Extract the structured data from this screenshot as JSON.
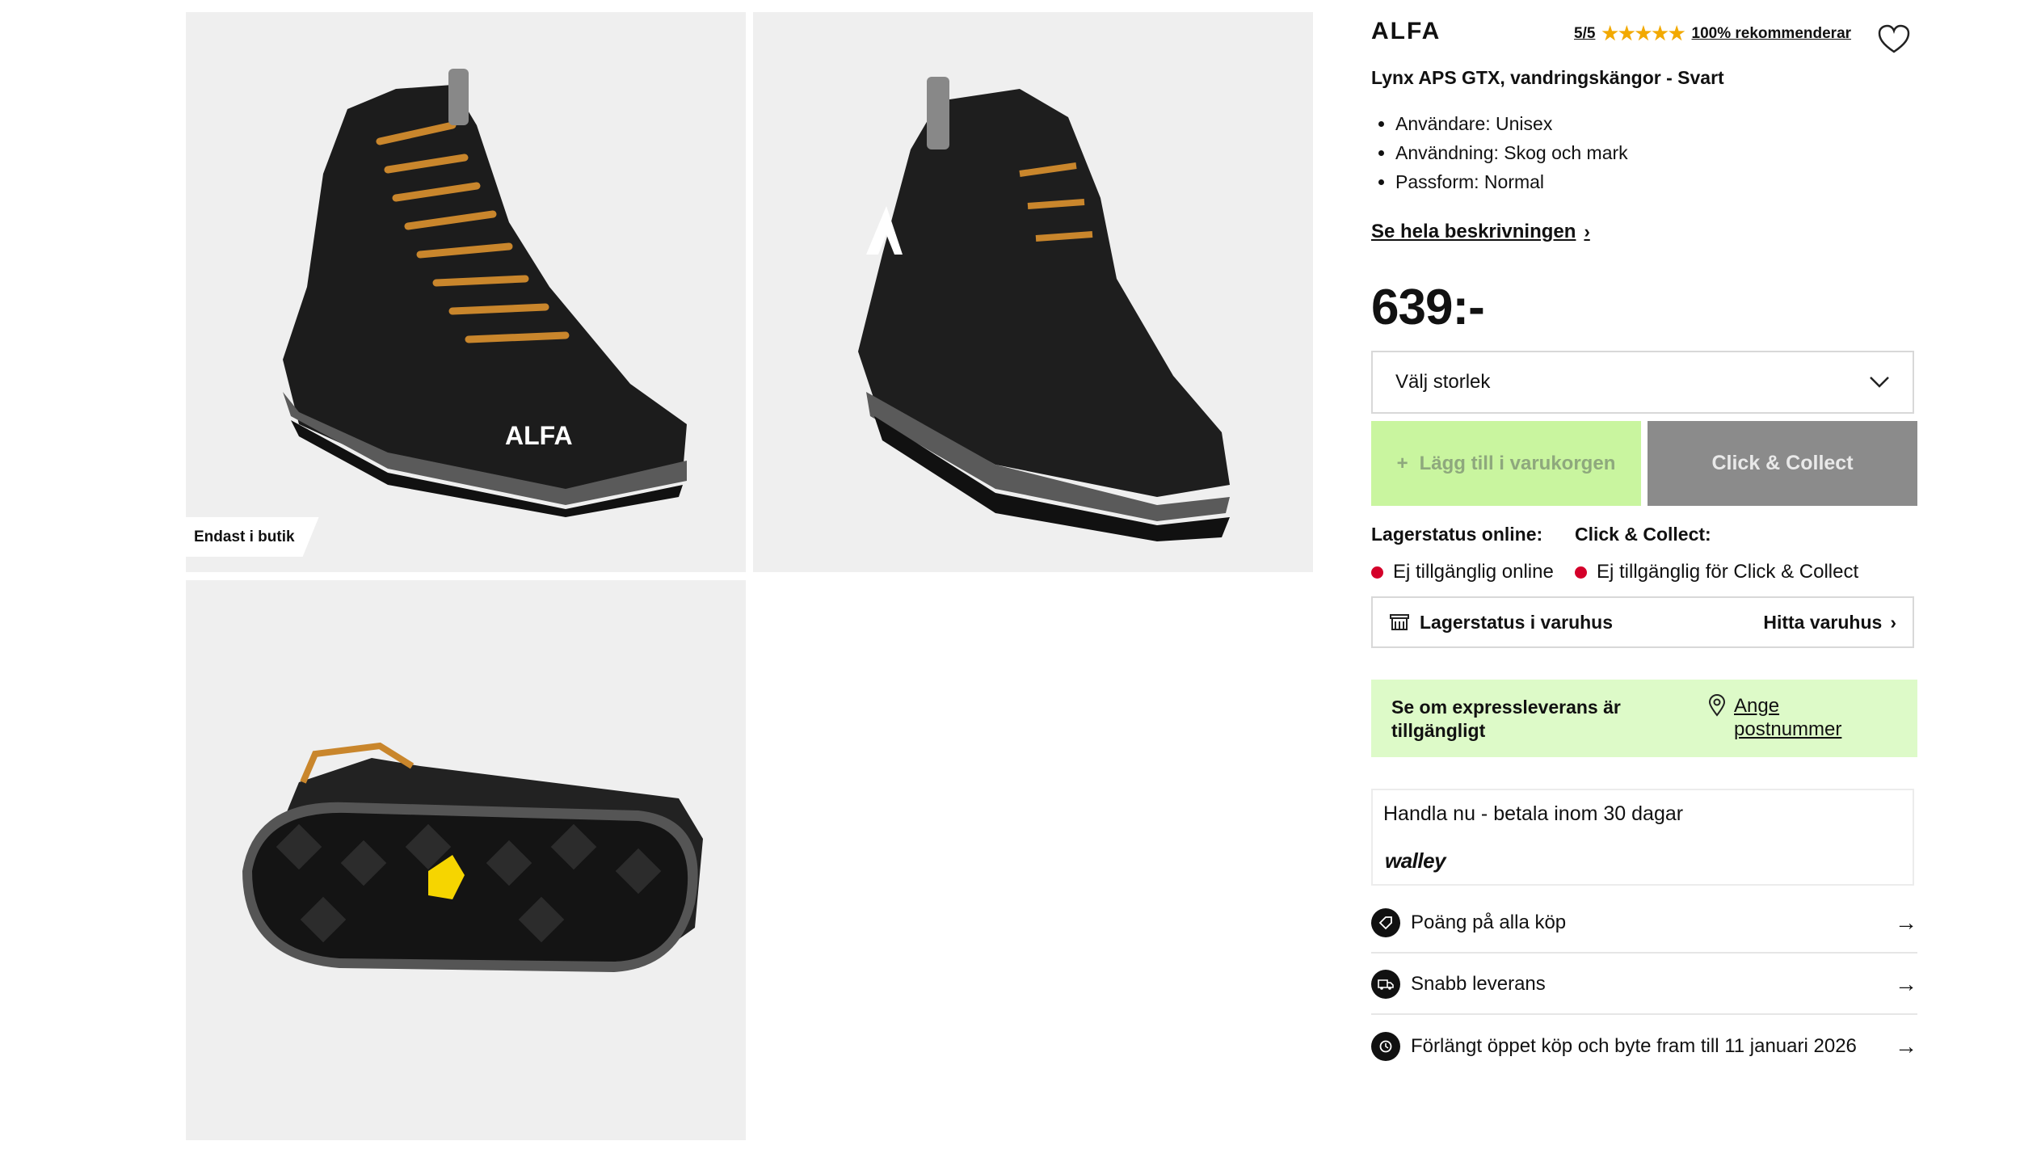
{
  "gallery": {
    "badge": "Endast i butik",
    "boot_brand_mark": "ALFA"
  },
  "product": {
    "brand": "ALFA",
    "rating_score": "5/5",
    "stars": "★★★★★",
    "recommend": "100% rekommenderar",
    "title": "Lynx APS GTX, vandringskängor - Svart",
    "specs": [
      "Användare: Unisex",
      "Användning: Skog och mark",
      "Passform: Normal"
    ],
    "description_link": "Se hela beskrivningen",
    "price": "639:-"
  },
  "purchase": {
    "size_placeholder": "Välj storlek",
    "add_to_cart": "Lägg till i varukorgen",
    "click_collect": "Click & Collect"
  },
  "stock": {
    "online_label": "Lagerstatus online:",
    "online_value": "Ej tillgänglig online",
    "cc_label": "Click & Collect:",
    "cc_value": "Ej tillgänglig för Click & Collect",
    "store_label": "Lagerstatus i varuhus",
    "store_link": "Hitta varuhus"
  },
  "express": {
    "text": "Se om expressleverans är tillgängligt",
    "link": "Ange postnummer"
  },
  "payment": {
    "text": "Handla nu - betala inom 30 dagar",
    "provider": "walley"
  },
  "usps": [
    {
      "label": "Poäng på alla köp",
      "icon": "tag-icon"
    },
    {
      "label": "Snabb leverans",
      "icon": "truck-icon"
    },
    {
      "label": "Förlängt öppet köp och byte fram till 11 januari 2026",
      "icon": "return-icon"
    }
  ],
  "colors": {
    "accent_green": "#c9f59f",
    "express_bg": "#ddfac8",
    "status_red": "#d4002a",
    "star": "#f2a900"
  }
}
